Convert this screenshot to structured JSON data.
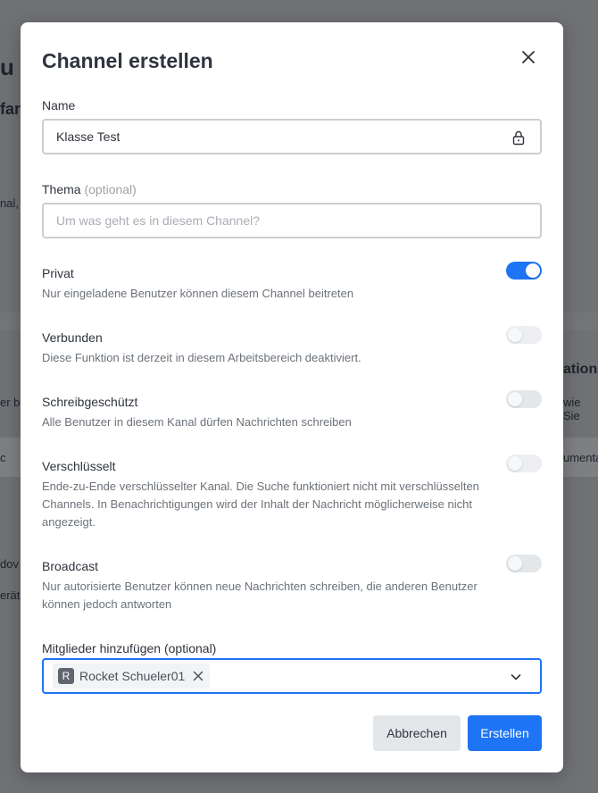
{
  "background": {
    "frag_title": "u l",
    "frag_sub": "fan",
    "frag_left1": "nal,",
    "frag_left2": "er b",
    "frag_left3": "c",
    "frag_left4": "dov",
    "frag_left5": "eräte",
    "frag_right1": "ation",
    "frag_right2": "wie Sie",
    "frag_right3": "umenta"
  },
  "modal": {
    "title": "Channel erstellen",
    "name": {
      "label": "Name",
      "value": "Klasse Test"
    },
    "topic": {
      "label": "Thema",
      "optional": "(optional)",
      "placeholder": "Um was geht es in diesem Channel?"
    },
    "toggles": [
      {
        "title": "Privat",
        "description": "Nur eingeladene Benutzer können diesem Channel beitreten",
        "on": true
      },
      {
        "title": "Verbunden",
        "description": "Diese Funktion ist derzeit in diesem Arbeitsbereich deaktiviert.",
        "on": false
      },
      {
        "title": "Schreibgeschützt",
        "description": "Alle Benutzer in diesem Kanal dürfen Nachrichten schreiben",
        "on": false
      },
      {
        "title": "Verschlüsselt",
        "description": "Ende-zu-Ende verschlüsselter Kanal. Die Suche funktioniert nicht mit verschlüsselten Channels. In Benachrichtigungen wird der Inhalt der Nachricht möglicherweise nicht angezeigt.",
        "on": false
      },
      {
        "title": "Broadcast",
        "description": "Nur autorisierte Benutzer können neue Nachrichten schreiben, die anderen Benutzer können jedoch antworten",
        "on": false
      }
    ],
    "members": {
      "label": "Mitglieder hinzufügen (optional)",
      "chips": [
        {
          "avatar_letter": "R",
          "name": "Rocket Schueler01"
        }
      ]
    },
    "buttons": {
      "cancel": "Abbrechen",
      "create": "Erstellen"
    }
  },
  "colors": {
    "accent": "#1d74f5",
    "overlay": "#6f7175",
    "text": "#2f343d",
    "muted": "#6c727a"
  },
  "icons": {
    "close": "close-icon",
    "lock": "lock-icon",
    "chip_remove": "close-icon",
    "dropdown": "chevron-down-icon"
  }
}
